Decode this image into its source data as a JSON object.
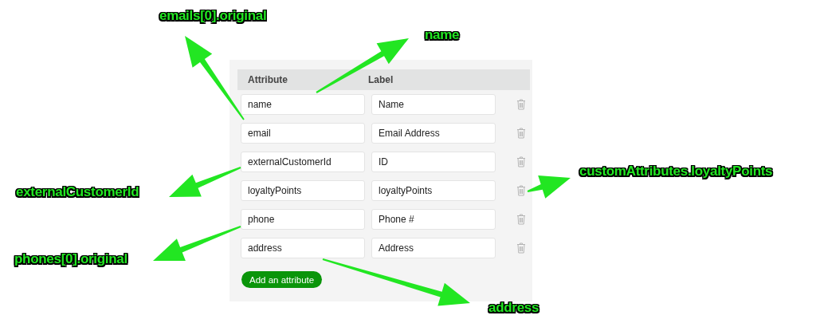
{
  "table": {
    "columns": [
      "Attribute",
      "Label"
    ],
    "rows": [
      {
        "attribute": "name",
        "label": "Name"
      },
      {
        "attribute": "email",
        "label": "Email Address"
      },
      {
        "attribute": "externalCustomerId",
        "label": "ID"
      },
      {
        "attribute": "loyaltyPoints",
        "label": "loyaltyPoints"
      },
      {
        "attribute": "phone",
        "label": "Phone #"
      },
      {
        "attribute": "address",
        "label": "Address"
      }
    ]
  },
  "add_button": "Add an attribute",
  "annotations": [
    "emails[0].original",
    "name",
    "externalCustomerId",
    "customAttributes.loyaltyPoints",
    "phones[0].original",
    "address"
  ]
}
